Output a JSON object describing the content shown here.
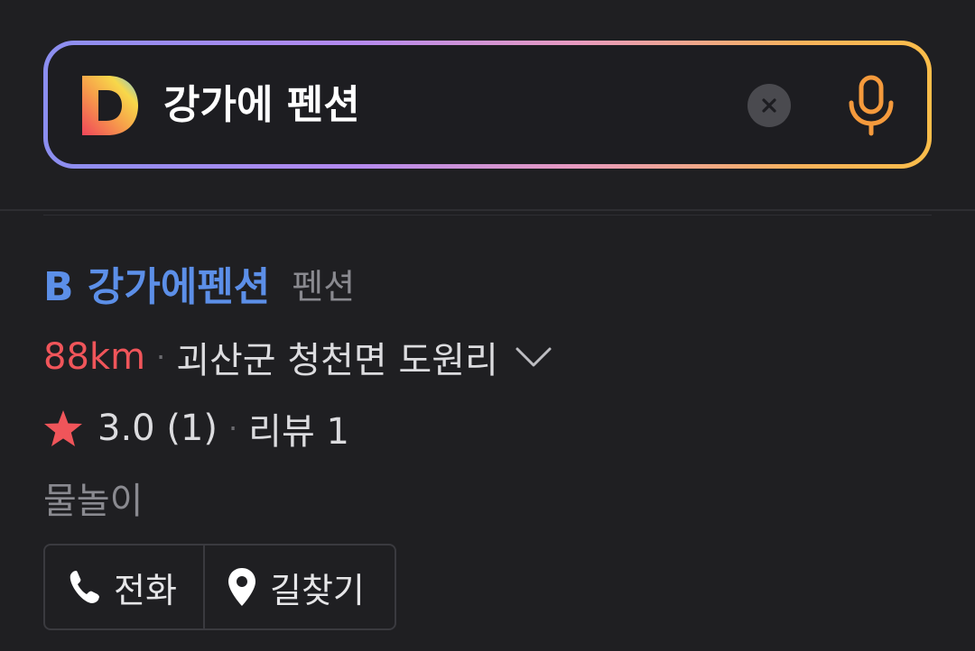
{
  "search": {
    "query": "강가에 펜션",
    "logo_letter": "D",
    "clear_icon": "close-icon",
    "mic_icon": "microphone-icon",
    "gradient_colors": [
      "#8b8ef0",
      "#b48af0",
      "#e79ac0",
      "#f7b25c",
      "#fbbd4a"
    ]
  },
  "result": {
    "name": "B 강가에펜션",
    "category": "펜션",
    "distance": "88km",
    "separator": "·",
    "address": "괴산군 청천면 도원리",
    "rating": "3.0 (1)",
    "review_label": "리뷰 1",
    "tag": "물놀이",
    "colors": {
      "name": "#5c8fe8",
      "distance": "#f0555a",
      "star": "#f0555a"
    }
  },
  "actions": {
    "call_label": "전화",
    "route_label": "길찾기",
    "call_icon": "phone-icon",
    "route_icon": "map-pin-icon"
  }
}
